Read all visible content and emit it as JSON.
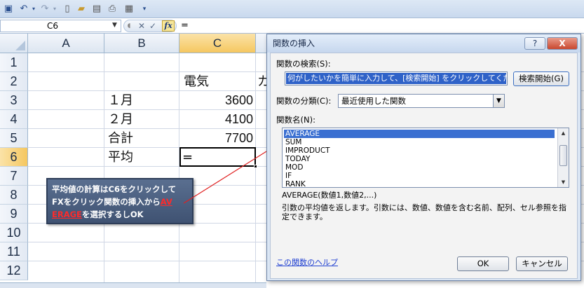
{
  "toolbar": {
    "icons": [
      "save-icon",
      "undo-icon",
      "redo-icon",
      "new-icon",
      "open-icon",
      "print-preview-icon",
      "print-icon",
      "customize-icon"
    ]
  },
  "formula_bar": {
    "name_box": "C6",
    "cancel_symbol": "✕",
    "enter_symbol": "✓",
    "fx_label": "fx",
    "formula": "="
  },
  "sheet": {
    "columns": [
      "A",
      "B",
      "C"
    ],
    "rows": [
      "1",
      "2",
      "3",
      "4",
      "5",
      "6",
      "7",
      "8",
      "9",
      "10",
      "11",
      "12"
    ],
    "cells": {
      "C2": "電気",
      "D2_partial": "カ",
      "B3": "１月",
      "C3": "3600",
      "B4": "２月",
      "C4": "4100",
      "B5": "合計",
      "C5": "7700",
      "B6": "平均",
      "C6": "="
    },
    "selected_cell": "C6"
  },
  "callout": {
    "line1": "平均値の計算はC6をクリックして",
    "line2_prefix": "FXをクリック関数の挿入から",
    "line2_highlight": "AV",
    "line3_highlight": "ERAGE",
    "line3_suffix": "を選択するしOK"
  },
  "dialog": {
    "title": "関数の挿入",
    "help_button": "?",
    "close_button": "X",
    "search_label": "関数の検索(S):",
    "search_value": "何がしたいかを簡単に入力して、[検索開始] をクリックしてください。",
    "search_button": "検索開始(G)",
    "category_label": "関数の分類(C):",
    "category_value": "最近使用した関数",
    "function_list_label": "関数名(N):",
    "functions": [
      "AVERAGE",
      "SUM",
      "IMPRODUCT",
      "TODAY",
      "MOD",
      "IF",
      "RANK"
    ],
    "selected_function": "AVERAGE",
    "syntax": "AVERAGE(数値1,数値2,...)",
    "description": "引数の平均値を返します。引数には、数値、数値を含む名前、配列、セル参照を指定できます。",
    "help_link": "この関数のヘルプ",
    "ok_button": "OK",
    "cancel_button": "キャンセル"
  }
}
